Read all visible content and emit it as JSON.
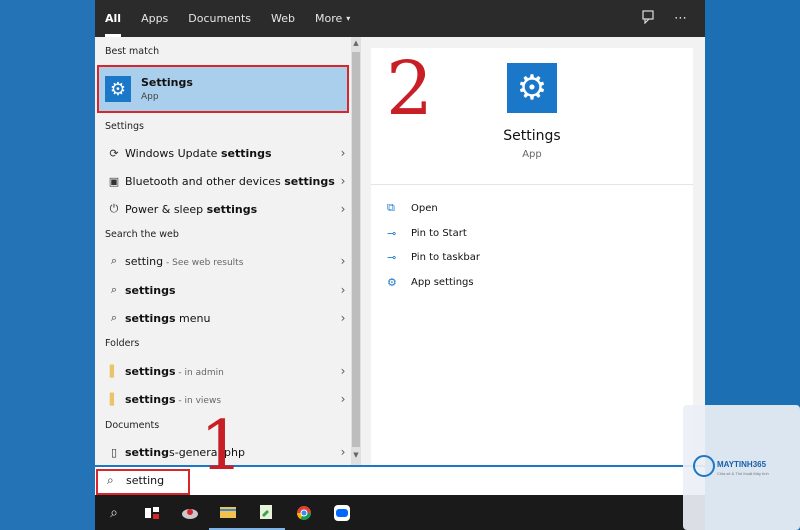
{
  "tabs": [
    {
      "label": "All",
      "active": true
    },
    {
      "label": "Apps"
    },
    {
      "label": "Documents"
    },
    {
      "label": "Web"
    },
    {
      "label": "More",
      "caret": "▾"
    }
  ],
  "tabbar_icons": [
    "feedback-icon",
    "more-options-icon"
  ],
  "sections": {
    "best_match": "Best match",
    "settings": "Settings",
    "search_web": "Search the web",
    "folders": "Folders",
    "documents": "Documents"
  },
  "best_match": {
    "title": "Settings",
    "subtitle": "App"
  },
  "settings_items": [
    {
      "prefix": "Windows Update ",
      "bold": "settings",
      "icon": "refresh-icon"
    },
    {
      "prefix": "Bluetooth and other devices ",
      "bold": "settings",
      "icon": "devices-icon"
    },
    {
      "prefix": "Power & sleep ",
      "bold": "settings",
      "icon": "power-icon"
    }
  ],
  "web_items": [
    {
      "prefix": "setting",
      "bold": "",
      "sub": " - See web results"
    },
    {
      "prefix": "",
      "bold": "settings",
      "sub": ""
    },
    {
      "prefix": "",
      "bold": "settings",
      "suffix": " menu",
      "sub": ""
    }
  ],
  "folder_items": [
    {
      "bold": "settings",
      "sub": " - in admin"
    },
    {
      "bold": "settings",
      "sub": " - in views"
    }
  ],
  "document_items": [
    {
      "bold": "setting",
      "rest": "s-general.php"
    }
  ],
  "preview": {
    "title": "Settings",
    "subtitle": "App",
    "actions": [
      {
        "label": "Open",
        "icon": "open-icon"
      },
      {
        "label": "Pin to Start",
        "icon": "pin-icon"
      },
      {
        "label": "Pin to taskbar",
        "icon": "pin-icon"
      },
      {
        "label": "App settings",
        "icon": "gear-icon"
      }
    ]
  },
  "search": {
    "value": "setting"
  },
  "annotations": {
    "one": "1",
    "two": "2"
  },
  "logo": {
    "name": "MAYTINH365",
    "tagline": "Chia sẻ & Thủ thuật Máy tính"
  },
  "colors": {
    "accent": "#1b78c9",
    "highlight": "#a9cfec",
    "annotation": "#c81e25"
  }
}
